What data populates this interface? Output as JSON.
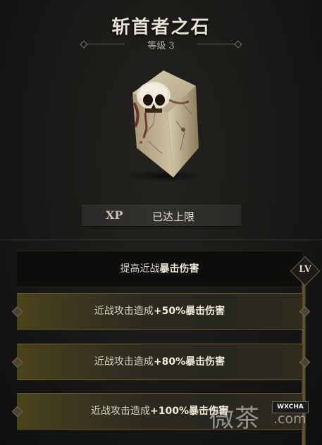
{
  "item": {
    "name": "斩首者之石",
    "level_label": "等级",
    "level_value": "3"
  },
  "xp": {
    "label": "XP",
    "status": "已达上限"
  },
  "upgrades": {
    "badge": "LV",
    "header": {
      "prefix": "提高近战",
      "highlight": "暴击伤害"
    },
    "rows": [
      {
        "prefix": "近战攻击造成",
        "amount": "+50%",
        "highlight": "暴击伤害"
      },
      {
        "prefix": "近战攻击造成",
        "amount": "+80%",
        "highlight": "暴击伤害"
      },
      {
        "prefix": "近战攻击造成",
        "amount": "+100%",
        "highlight": "暴击伤害"
      }
    ]
  },
  "watermark": {
    "logo": "微茶",
    "dot": ".com",
    "badge": "WXCHA"
  },
  "colors": {
    "accent_gold": "#6b5f3c",
    "highlight_text": "#f0ead8",
    "background": "#181816"
  },
  "icons": [
    "skull-stone-icon",
    "diamond-ornament-icon"
  ]
}
